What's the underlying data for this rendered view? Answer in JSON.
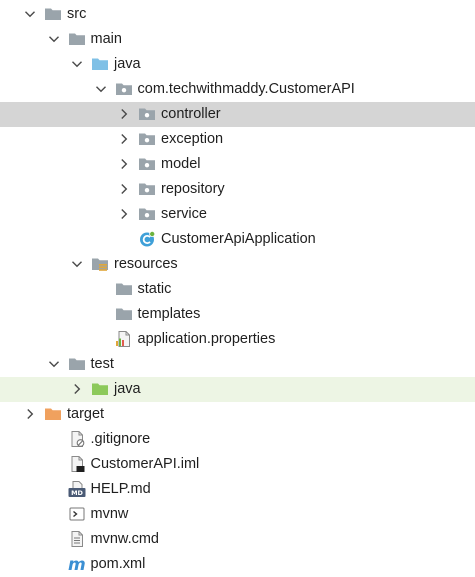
{
  "colors": {
    "selected_row": "#d5d5d5",
    "test_row": "#edf5e4",
    "folder": "#9aa4ab",
    "source_folder": "#7fc0e6",
    "test_folder": "#8cc95a",
    "excluded_folder": "#f0a15e"
  },
  "tree": [
    {
      "name": "node-src",
      "label": "src",
      "depth": 0,
      "expanded": true,
      "icon": "folder-icon"
    },
    {
      "name": "node-main",
      "label": "main",
      "depth": 1,
      "expanded": true,
      "icon": "folder-icon"
    },
    {
      "name": "node-java",
      "label": "java",
      "depth": 2,
      "expanded": true,
      "icon": "source-folder-icon"
    },
    {
      "name": "node-package-customerapi",
      "label": "com.techwithmaddy.CustomerAPI",
      "depth": 3,
      "expanded": true,
      "icon": "package-icon"
    },
    {
      "name": "node-controller",
      "label": "controller",
      "depth": 4,
      "expanded": false,
      "icon": "package-icon",
      "selected": true
    },
    {
      "name": "node-exception",
      "label": "exception",
      "depth": 4,
      "expanded": false,
      "icon": "package-icon"
    },
    {
      "name": "node-model",
      "label": "model",
      "depth": 4,
      "expanded": false,
      "icon": "package-icon"
    },
    {
      "name": "node-repository",
      "label": "repository",
      "depth": 4,
      "expanded": false,
      "icon": "package-icon"
    },
    {
      "name": "node-service",
      "label": "service",
      "depth": 4,
      "expanded": false,
      "icon": "package-icon"
    },
    {
      "name": "node-customerapiapplication",
      "label": "CustomerApiApplication",
      "depth": 4,
      "icon": "spring-boot-class-icon"
    },
    {
      "name": "node-resources",
      "label": "resources",
      "depth": 2,
      "expanded": true,
      "icon": "resources-folder-icon"
    },
    {
      "name": "node-static",
      "label": "static",
      "depth": 3,
      "icon": "folder-icon"
    },
    {
      "name": "node-templates",
      "label": "templates",
      "depth": 3,
      "icon": "folder-icon"
    },
    {
      "name": "node-application-properties",
      "label": "application.properties",
      "depth": 3,
      "icon": "properties-file-icon"
    },
    {
      "name": "node-test",
      "label": "test",
      "depth": 1,
      "expanded": true,
      "icon": "folder-icon"
    },
    {
      "name": "node-test-java",
      "label": "java",
      "depth": 2,
      "expanded": false,
      "icon": "test-folder-icon",
      "highlight": "test"
    },
    {
      "name": "node-target",
      "label": "target",
      "depth": 0,
      "expanded": false,
      "icon": "excluded-folder-icon"
    },
    {
      "name": "node-gitignore",
      "label": ".gitignore",
      "depth": 1,
      "icon": "ignored-file-icon"
    },
    {
      "name": "node-customerapi-iml",
      "label": "CustomerAPI.iml",
      "depth": 1,
      "icon": "iml-file-icon"
    },
    {
      "name": "node-help-md",
      "label": "HELP.md",
      "depth": 1,
      "icon": "markdown-file-icon"
    },
    {
      "name": "node-mvnw",
      "label": "mvnw",
      "depth": 1,
      "icon": "shell-script-icon"
    },
    {
      "name": "node-mvnw-cmd",
      "label": "mvnw.cmd",
      "depth": 1,
      "icon": "text-file-icon"
    },
    {
      "name": "node-pom-xml",
      "label": "pom.xml",
      "depth": 1,
      "icon": "maven-file-icon"
    }
  ]
}
